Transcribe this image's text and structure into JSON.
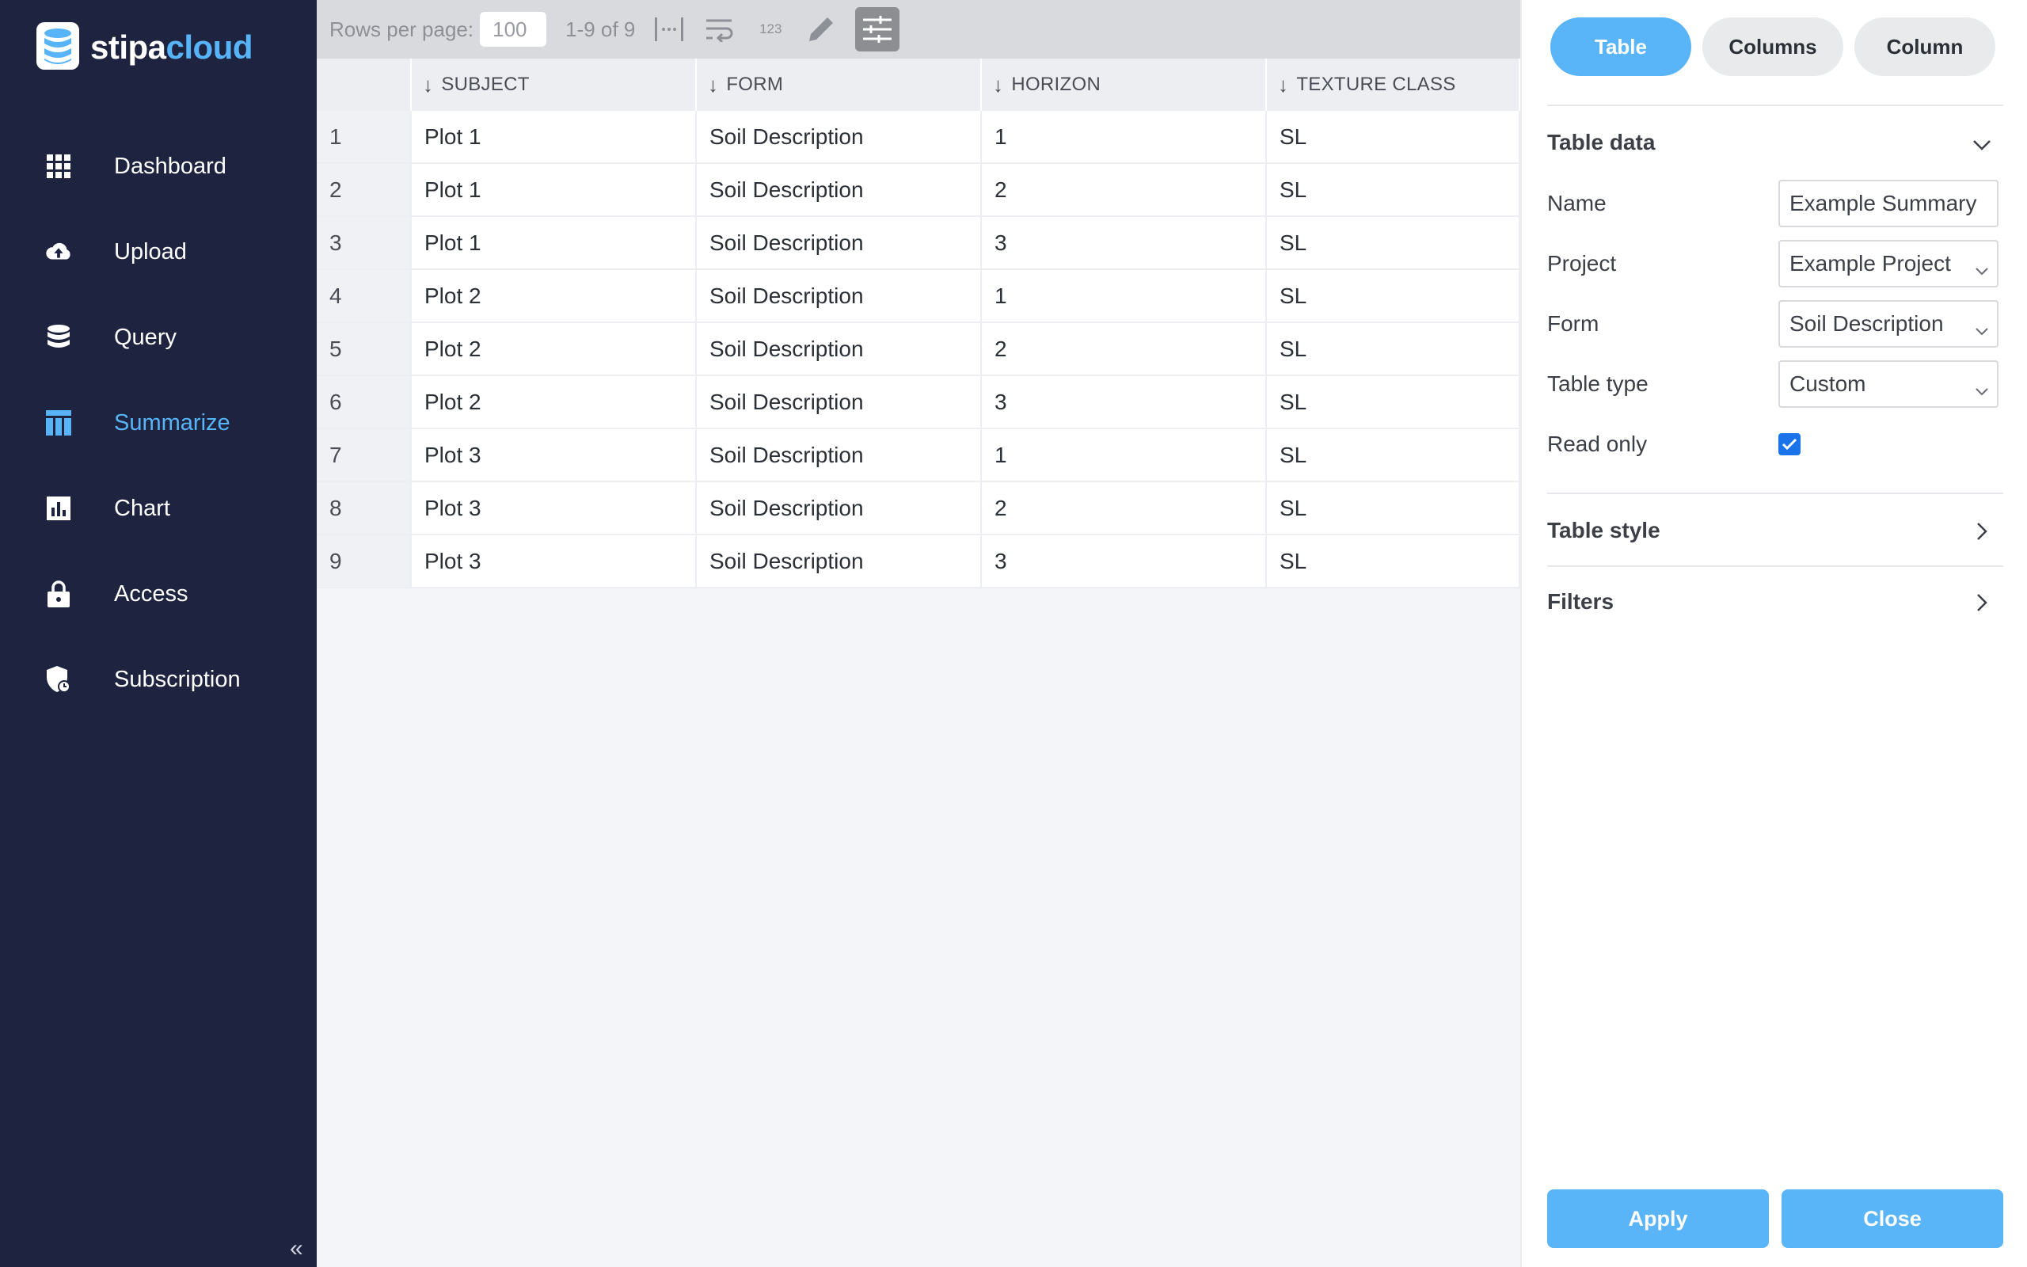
{
  "brand": {
    "name_part1": "stipa",
    "name_part2": "cloud"
  },
  "nav": [
    {
      "label": "Dashboard",
      "icon": "grid-icon",
      "active": false
    },
    {
      "label": "Upload",
      "icon": "cloud-upload-icon",
      "active": false
    },
    {
      "label": "Query",
      "icon": "database-icon",
      "active": false
    },
    {
      "label": "Summarize",
      "icon": "table-icon",
      "active": true
    },
    {
      "label": "Chart",
      "icon": "bar-chart-icon",
      "active": false
    },
    {
      "label": "Access",
      "icon": "lock-icon",
      "active": false
    },
    {
      "label": "Subscription",
      "icon": "shield-icon",
      "active": false
    }
  ],
  "toolbar": {
    "rows_per_page_label": "Rows per page:",
    "rows_per_page_value": "100",
    "range": "1-9 of 9",
    "numeric_icon_text": "123"
  },
  "table": {
    "columns": [
      "SUBJECT",
      "FORM",
      "HORIZON",
      "TEXTURE CLASS"
    ],
    "rows": [
      {
        "index": "1",
        "subject": "Plot 1",
        "form": "Soil Description",
        "horizon": "1",
        "texture": "SL"
      },
      {
        "index": "2",
        "subject": "Plot 1",
        "form": "Soil Description",
        "horizon": "2",
        "texture": "SL"
      },
      {
        "index": "3",
        "subject": "Plot 1",
        "form": "Soil Description",
        "horizon": "3",
        "texture": "SL"
      },
      {
        "index": "4",
        "subject": "Plot 2",
        "form": "Soil Description",
        "horizon": "1",
        "texture": "SL"
      },
      {
        "index": "5",
        "subject": "Plot 2",
        "form": "Soil Description",
        "horizon": "2",
        "texture": "SL"
      },
      {
        "index": "6",
        "subject": "Plot 2",
        "form": "Soil Description",
        "horizon": "3",
        "texture": "SL"
      },
      {
        "index": "7",
        "subject": "Plot 3",
        "form": "Soil Description",
        "horizon": "1",
        "texture": "SL"
      },
      {
        "index": "8",
        "subject": "Plot 3",
        "form": "Soil Description",
        "horizon": "2",
        "texture": "SL"
      },
      {
        "index": "9",
        "subject": "Plot 3",
        "form": "Soil Description",
        "horizon": "3",
        "texture": "SL"
      }
    ]
  },
  "panel": {
    "tabs": [
      "Table",
      "Columns",
      "Column"
    ],
    "active_tab": "Table",
    "table_data_title": "Table data",
    "fields": {
      "name_label": "Name",
      "name_value": "Example Summary",
      "project_label": "Project",
      "project_value": "Example Project",
      "form_label": "Form",
      "form_value": "Soil Description",
      "table_type_label": "Table type",
      "table_type_value": "Custom",
      "read_only_label": "Read only",
      "read_only_checked": true
    },
    "table_style_title": "Table style",
    "filters_title": "Filters",
    "apply_label": "Apply",
    "close_label": "Close"
  },
  "colors": {
    "sidebar_bg": "#1e2440",
    "accent": "#5ab4f8",
    "checkbox": "#1a73e8"
  }
}
